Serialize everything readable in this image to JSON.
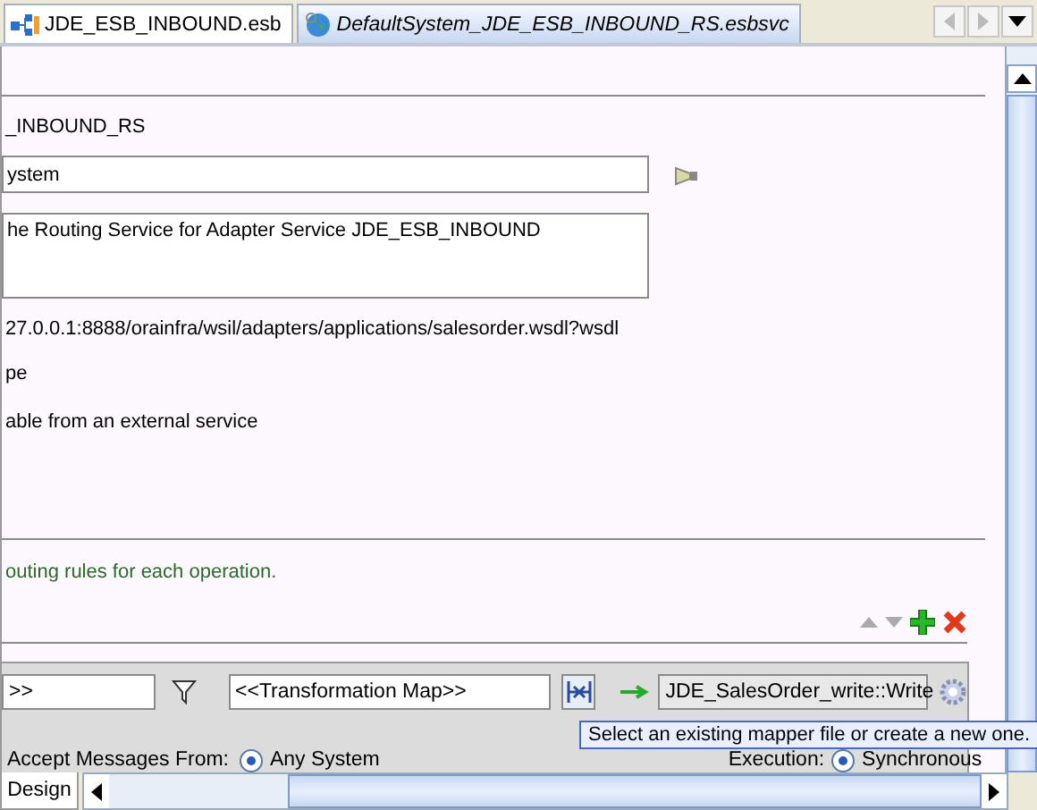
{
  "tabs": [
    {
      "label": "JDE_ESB_INBOUND.esb",
      "kind": "esb",
      "selected": false
    },
    {
      "label": "DefaultSystem_JDE_ESB_INBOUND_RS.esbsvc",
      "kind": "service",
      "selected": true
    }
  ],
  "form": {
    "name": "_INBOUND_RS",
    "system_field": {
      "value": "ystem"
    },
    "description_field": {
      "value": "he Routing Service for Adapter Service JDE_ESB_INBOUND"
    },
    "wsdl_url": "27.0.0.1:8888/orainfra/wsil/adapters/applications/salesorder.wsdl?wsdl",
    "port_type": "pe",
    "invocable": "able from an external service"
  },
  "routing": {
    "hint": "outing rules for each operation.",
    "rule": {
      "filter_field": {
        "value": ">>"
      },
      "transformation_field": {
        "value": "<<Transformation Map>>"
      },
      "target_field": {
        "value": "JDE_SalesOrder_write::Write"
      },
      "accept_label": "Accept Messages From:",
      "accept_options": [
        {
          "label": "Any System",
          "selected": true
        }
      ],
      "execution_label": "Execution:",
      "execution_options": [
        {
          "label": "Synchronous",
          "selected": true
        }
      ]
    },
    "tooltip": "Select an existing mapper file or create a new one."
  },
  "bottom_tabs": [
    {
      "label": "Design",
      "selected": true
    }
  ]
}
